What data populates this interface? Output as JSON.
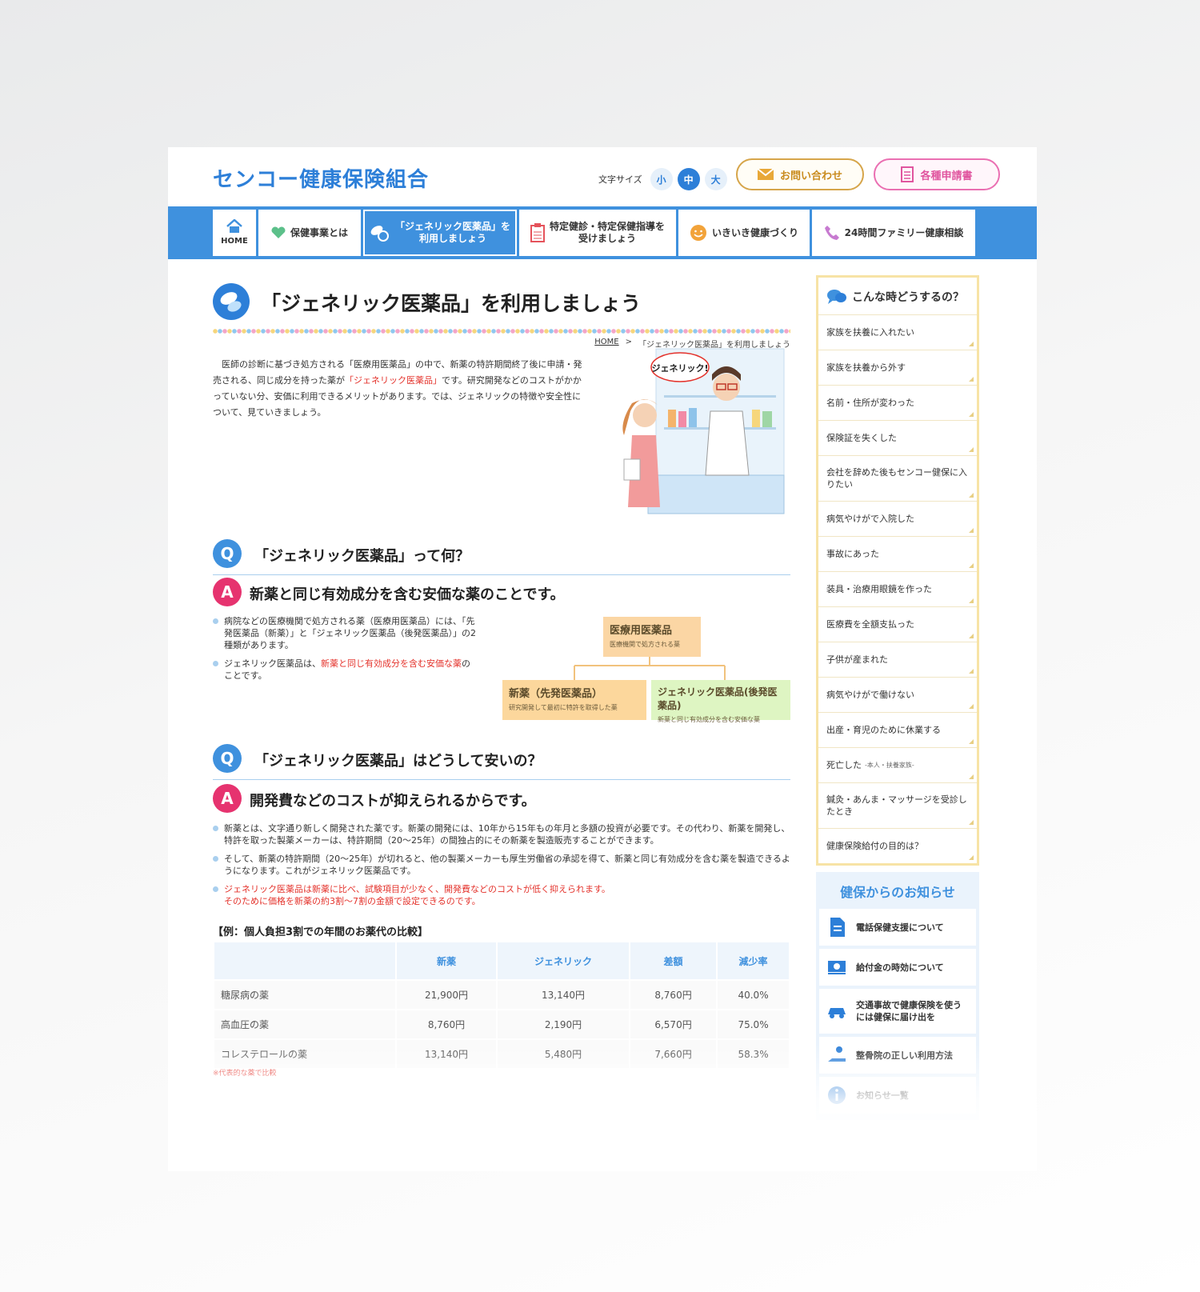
{
  "header": {
    "logo": "センコー健康保険組合",
    "font_size_label": "文字サイズ",
    "font_sizes": [
      "小",
      "中",
      "大"
    ],
    "contact": "お問い合わせ",
    "forms": "各種申請書"
  },
  "nav": {
    "home": "HOME",
    "items": [
      "保健事業とは",
      "「ジェネリック医薬品」を\n利用しましょう",
      "特定健診・特定保健指導を\n受けましょう",
      "いきいき健康づくり",
      "24時間ファミリー健康相談"
    ]
  },
  "page": {
    "title": "「ジェネリック医薬品」を利用しましょう",
    "breadcrumb_home": "HOME",
    "breadcrumb_sep": ">",
    "breadcrumb_current": "「ジェネリック医薬品」を利用しましょう",
    "intro_1": "医師の診断に基づき処方される「医療用医薬品」の中で、新薬の特許期間終了後に申請・発売される、同じ成分を持った薬が",
    "intro_red": "「ジェネリック医薬品」",
    "intro_2": "です。研究開発などのコストがかかっていない分、安価に利用できるメリットがあります。では、ジェネリックの特徴や安全性について、見ていきましょう。",
    "illustration_bubble": "ジェネリック!"
  },
  "qa1": {
    "q_label": "Q",
    "a_label": "A",
    "question": "「ジェネリック医薬品」って何？",
    "answer": "新薬と同じ有効成分を含む安価な薬のことです。",
    "bullet1": "病院などの医療機関で処方される薬（医療用医薬品）には、「先発医薬品（新薬）」と「ジェネリック医薬品（後発医薬品）」の2種類があります。",
    "bullet2_a": "ジェネリック医薬品は、",
    "bullet2_red": "新薬と同じ有効成分を含む安価な薬",
    "bullet2_b": "のことです。",
    "diagram": {
      "top_title": "医療用医薬品",
      "top_sub": "医療機関で処方される薬",
      "left_title": "新薬（先発医薬品）",
      "left_sub": "研究開発して最初に特許を取得した薬",
      "right_title": "ジェネリック医薬品(後発医薬品)",
      "right_sub": "新薬と同じ有効成分を含む安価な薬"
    }
  },
  "qa2": {
    "q_label": "Q",
    "a_label": "A",
    "question": "「ジェネリック医薬品」はどうして安いの？",
    "answer": "開発費などのコストが抑えられるからです。",
    "bullet1": "新薬とは、文字通り新しく開発された薬です。新薬の開発には、10年から15年もの年月と多額の投資が必要です。その代わり、新薬を開発し、特許を取った製薬メーカーは、特許期間（20〜25年）の間独占的にその新薬を製造販売することができます。",
    "bullet2": "そして、新薬の特許期間（20〜25年）が切れると、他の製薬メーカーも厚生労働省の承認を得て、新薬と同じ有効成分を含む薬を製造できるようになります。これがジェネリック医薬品です。",
    "bullet3_red": "ジェネリック医薬品は新薬に比べ、試験項目が少なく、開発費などのコストが低く抑えられます。\nそのために価格を新薬の約3割〜7割の金額で設定できるのです。"
  },
  "example": {
    "title": "【例：個人負担3割での年間のお薬代の比較】",
    "headers": [
      "",
      "新薬",
      "ジェネリック",
      "差額",
      "減少率"
    ],
    "rows": [
      [
        "糖尿病の薬",
        "21,900円",
        "13,140円",
        "8,760円",
        "40.0%"
      ],
      [
        "高血圧の薬",
        "8,760円",
        "2,190円",
        "6,570円",
        "75.0%"
      ],
      [
        "コレステロールの薬",
        "13,140円",
        "5,480円",
        "7,660円",
        "58.3%"
      ]
    ],
    "note": "※代表的な薬で比較"
  },
  "sidebar": {
    "title": "こんな時どうするの？",
    "items": [
      "家族を扶養に入れたい",
      "家族を扶養から外す",
      "名前・住所が変わった",
      "保険証を失くした",
      "会社を辞めた後もセンコー健保に入りたい",
      "病気やけがで入院した",
      "事故にあった",
      "装具・治療用眼鏡を作った",
      "医療費を全額支払った",
      "子供が産まれた",
      "病気やけがで働けない",
      "出産・育児のために休業する",
      "死亡した",
      "鍼灸・あんま・マッサージを受診したとき",
      "健康保険給付の目的は？"
    ],
    "death_sub": "-本人・扶養家族-"
  },
  "news": {
    "title": "健保からのお知らせ",
    "items": [
      "電話保健支援について",
      "給付金の時効について",
      "交通事故で健康保険を使うには健保に届け出を",
      "整骨院の正しい利用方法",
      "お知らせ一覧"
    ]
  },
  "colors": {
    "brand_blue": "#2d7fd8",
    "nav_blue": "#3f91de",
    "accent_pink": "#e6336f",
    "accent_red": "#e4322b"
  }
}
